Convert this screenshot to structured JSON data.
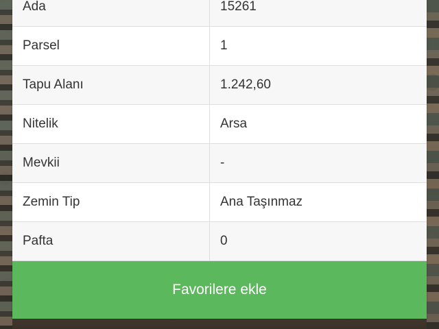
{
  "property_info": {
    "rows": [
      {
        "label": "Ada",
        "value": "15261"
      },
      {
        "label": "Parsel",
        "value": "1"
      },
      {
        "label": "Tapu Alanı",
        "value": "1.242,60"
      },
      {
        "label": "Nitelik",
        "value": "Arsa"
      },
      {
        "label": "Mevkii",
        "value": "-"
      },
      {
        "label": "Zemin Tip",
        "value": "Ana Taşınmaz"
      },
      {
        "label": "Pafta",
        "value": "0"
      }
    ]
  },
  "actions": {
    "favorite_label": "Favorilere ekle"
  },
  "colors": {
    "accent_green": "#5cb85c",
    "button_text": "#ffffff"
  }
}
